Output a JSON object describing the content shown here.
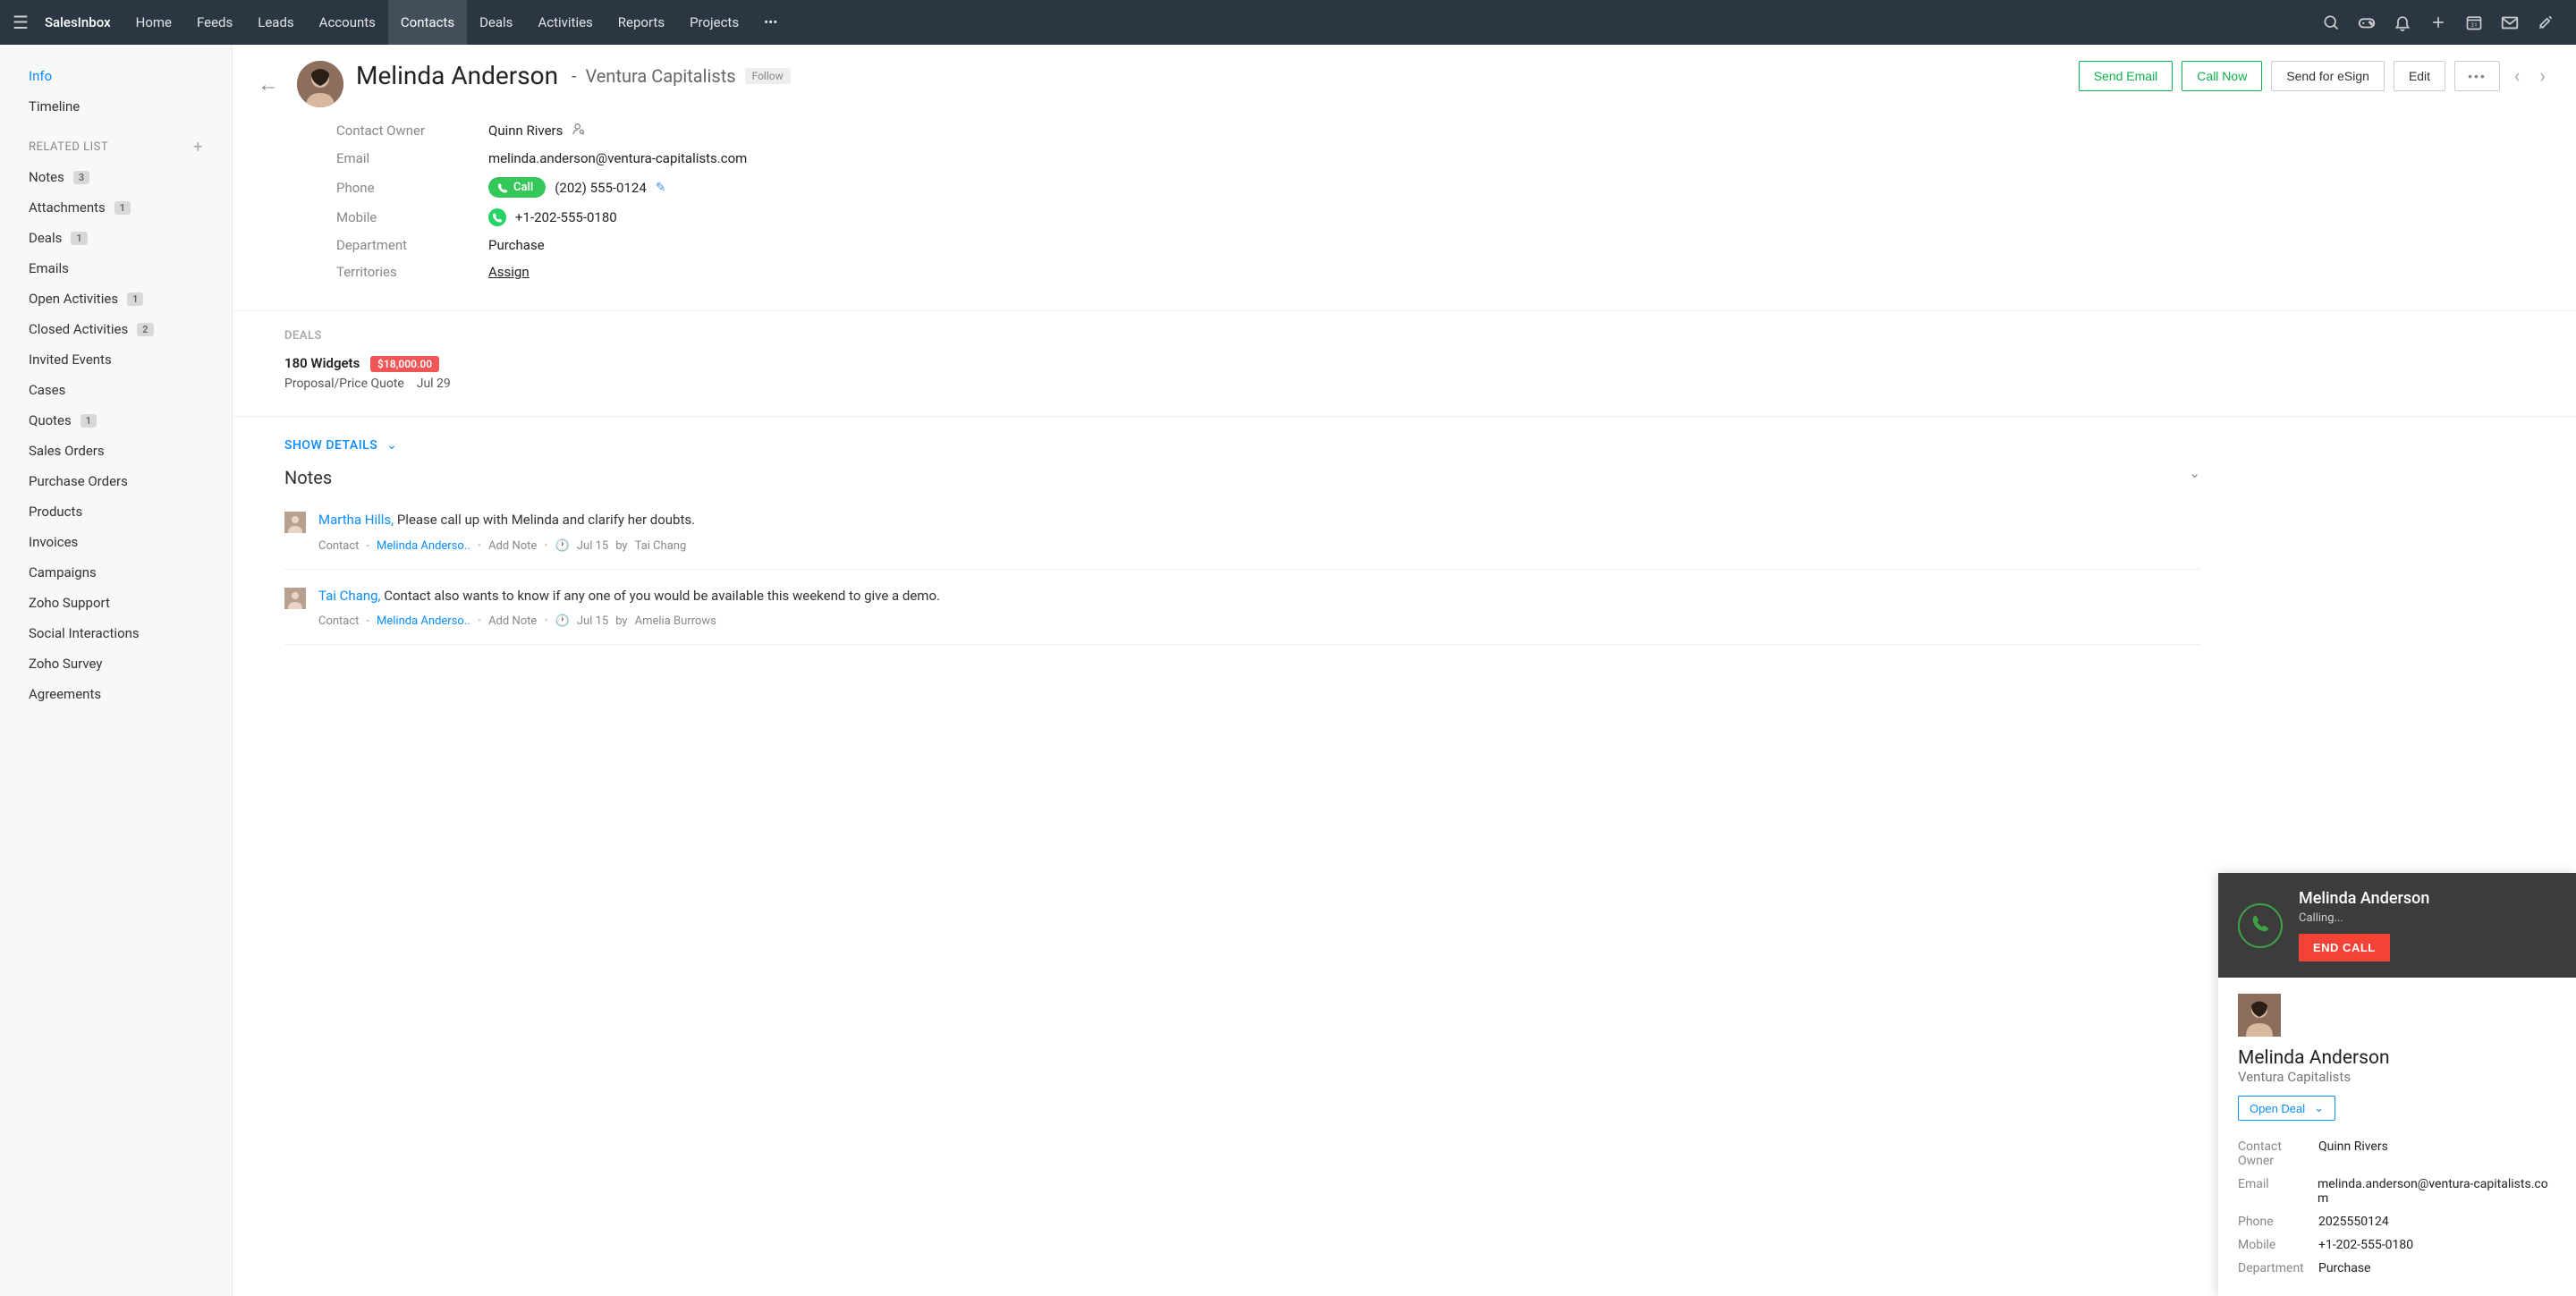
{
  "appName": "SalesInbox",
  "topNav": [
    "Home",
    "Feeds",
    "Leads",
    "Accounts",
    "Contacts",
    "Deals",
    "Activities",
    "Reports",
    "Projects"
  ],
  "topNavActive": "Contacts",
  "sidebar": {
    "primary": [
      {
        "label": "Info",
        "active": true
      },
      {
        "label": "Timeline"
      }
    ],
    "relatedHeader": "RELATED LIST",
    "related": [
      {
        "label": "Notes",
        "badge": "3"
      },
      {
        "label": "Attachments",
        "badge": "1"
      },
      {
        "label": "Deals",
        "badge": "1"
      },
      {
        "label": "Emails"
      },
      {
        "label": "Open Activities",
        "badge": "1"
      },
      {
        "label": "Closed Activities",
        "badge": "2"
      },
      {
        "label": "Invited Events"
      },
      {
        "label": "Cases"
      },
      {
        "label": "Quotes",
        "badge": "1"
      },
      {
        "label": "Sales Orders"
      },
      {
        "label": "Purchase Orders"
      },
      {
        "label": "Products"
      },
      {
        "label": "Invoices"
      },
      {
        "label": "Campaigns"
      },
      {
        "label": "Zoho Support"
      },
      {
        "label": "Social Interactions"
      },
      {
        "label": "Zoho Survey"
      },
      {
        "label": "Agreements"
      }
    ]
  },
  "contact": {
    "name": "Melinda Anderson",
    "company": "Ventura Capitalists",
    "follow": "Follow",
    "ownerLabel": "Contact Owner",
    "owner": "Quinn Rivers",
    "emailLabel": "Email",
    "email": "melinda.anderson@ventura-capitalists.com",
    "phoneLabel": "Phone",
    "callBtn": "Call",
    "phone": "(202) 555-0124",
    "mobileLabel": "Mobile",
    "mobile": "+1-202-555-0180",
    "departmentLabel": "Department",
    "department": "Purchase",
    "territoriesLabel": "Territories",
    "territoriesAction": "Assign"
  },
  "actions": {
    "sendEmail": "Send Email",
    "callNow": "Call Now",
    "sendESign": "Send for eSign",
    "edit": "Edit"
  },
  "deals": {
    "header": "DEALS",
    "name": "180 Widgets",
    "amount": "$18,000.00",
    "stage": "Proposal/Price Quote",
    "date": "Jul 29"
  },
  "showDetails": "SHOW DETAILS",
  "notes": {
    "title": "Notes",
    "moduleLabel": "Contact",
    "addNote": "Add Note",
    "relatedLink": "Melinda Anderso..",
    "items": [
      {
        "author": "Martha Hills,",
        "text": "Please call up with Melinda and clarify her doubts.",
        "date": "Jul 15",
        "by": "Tai Chang"
      },
      {
        "author": "Tai Chang,",
        "text": "Contact also wants to know if any one of you would be available this weekend to give a demo.",
        "date": "Jul 15",
        "by": "Amelia Burrows"
      }
    ]
  },
  "callPanel": {
    "name": "Melinda Anderson",
    "status": "Calling...",
    "endCall": "END CALL",
    "company": "Ventura Capitalists",
    "openDeal": "Open Deal",
    "details": {
      "ownerLabel": "Contact Owner",
      "owner": "Quinn Rivers",
      "emailLabel": "Email",
      "email": "melinda.anderson@ventura-capitalists.com",
      "phoneLabel": "Phone",
      "phone": "2025550124",
      "mobileLabel": "Mobile",
      "mobile": "+1-202-555-0180",
      "departmentLabel": "Department",
      "department": "Purchase"
    }
  }
}
